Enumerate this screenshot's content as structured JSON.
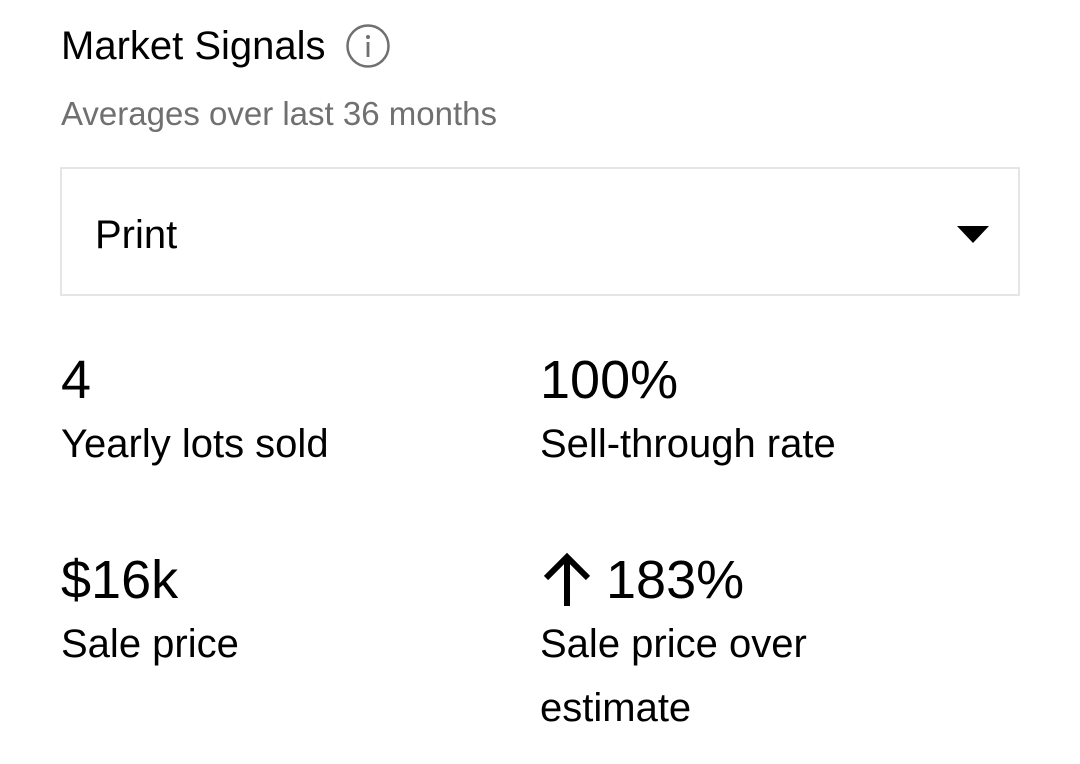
{
  "header": {
    "title": "Market Signals",
    "info_icon": "info-icon",
    "subtitle": "Averages over last 36 months"
  },
  "filter": {
    "selected": "Print",
    "caret_icon": "caret-down-icon"
  },
  "stats": [
    {
      "value": "4",
      "label": "Yearly lots sold"
    },
    {
      "value": "100%",
      "label": "Sell-through rate"
    },
    {
      "value": "$16k",
      "label": "Sale price"
    },
    {
      "value": "183%",
      "label": "Sale price over estimate",
      "trend_icon": "arrow-up-icon"
    }
  ],
  "colors": {
    "text": "#000000",
    "muted": "#707070",
    "border": "#e5e5e5"
  }
}
